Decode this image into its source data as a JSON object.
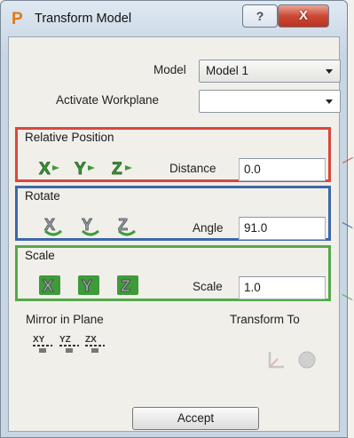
{
  "window": {
    "title": "Transform Model",
    "app_icon": "P",
    "help_glyph": "?",
    "close_glyph": "X"
  },
  "model": {
    "label": "Model",
    "value": "Model 1"
  },
  "workplane": {
    "label": "Activate Workplane",
    "value": ""
  },
  "relative_position": {
    "title": "Relative Position",
    "field_label": "Distance",
    "value": "0.0",
    "axes": [
      "X",
      "Y",
      "Z"
    ]
  },
  "rotate": {
    "title": "Rotate",
    "field_label": "Angle",
    "value": "91.0",
    "axes": [
      "X",
      "Y",
      "Z"
    ]
  },
  "scale": {
    "title": "Scale",
    "field_label": "Scale",
    "value": "1.0",
    "axes": [
      "X",
      "Y",
      "Z"
    ]
  },
  "mirror": {
    "title": "Mirror in Plane",
    "planes": [
      "XY",
      "YZ",
      "ZX"
    ]
  },
  "transform_to": {
    "title": "Transform To"
  },
  "accept_label": "Accept",
  "colors": {
    "relative_border": "#d9473b",
    "rotate_border": "#3b68a8",
    "scale_border": "#55a84a",
    "icon_green": "#3f9a3a"
  }
}
